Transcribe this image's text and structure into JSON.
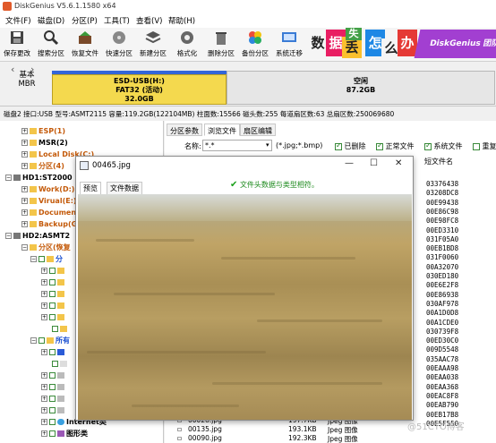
{
  "window": {
    "title": "DiskGenius V5.6.1.1580 x64"
  },
  "menu": [
    "文件(F)",
    "磁盘(D)",
    "分区(P)",
    "工具(T)",
    "查看(V)",
    "帮助(H)"
  ],
  "toolbar": {
    "buttons": [
      {
        "label": "保存更改",
        "icon": "save-icon"
      },
      {
        "label": "搜索分区",
        "icon": "search-icon"
      },
      {
        "label": "恢复文件",
        "icon": "recover-file-icon"
      },
      {
        "label": "快速分区",
        "icon": "quick-partition-icon"
      },
      {
        "label": "新建分区",
        "icon": "new-partition-icon"
      },
      {
        "label": "格式化",
        "icon": "format-icon"
      },
      {
        "label": "删除分区",
        "icon": "delete-icon"
      },
      {
        "label": "备份分区",
        "icon": "backup-icon"
      },
      {
        "label": "系统迁移",
        "icon": "migrate-icon"
      }
    ]
  },
  "banner": {
    "chars": [
      "数",
      "据",
      "丢",
      "失",
      "怎",
      "么",
      "办"
    ],
    "brand": "DiskGenius 团队"
  },
  "diskmap": {
    "label_line1": "基本",
    "label_line2": "MBR",
    "partition": {
      "name": "ESD-USB(H:)",
      "fs": "FAT32 (活动)",
      "size": "32.0GB"
    },
    "free": {
      "name": "空闲",
      "size": "87.2GB"
    }
  },
  "disk_info": "磁盘2 接口:USB  型号:ASMT2115  容量:119.2GB(122104MB)  柱面数:15566  磁头数:255  每道扇区数:63  总扇区数:250069680",
  "tree": [
    {
      "text": "ESP(1)",
      "style": "orange"
    },
    {
      "text": "MSR(2)",
      "style": "bold"
    },
    {
      "text": "Local Disk(C:)",
      "style": "orange"
    },
    {
      "text": "分区(4)",
      "style": "orange"
    },
    {
      "text": "HD1:ST2000",
      "style": "bold"
    },
    {
      "text": "Work(D:)",
      "style": "orange"
    },
    {
      "text": "Virual(E:)",
      "style": "orange"
    },
    {
      "text": "Documen",
      "style": "orange"
    },
    {
      "text": "Backup(G",
      "style": "orange"
    },
    {
      "text": "HD2:ASMT2",
      "style": "bold"
    },
    {
      "text": "分区(恢复",
      "style": "orange"
    },
    {
      "text": "分",
      "style": "blue"
    },
    {
      "text": "所有",
      "style": "blue"
    },
    {
      "text": "Internet类",
      "style": "bold"
    },
    {
      "text": "图形类",
      "style": "bold"
    }
  ],
  "right": {
    "tabs": [
      "分区参数",
      "浏览文件",
      "扇区编辑"
    ],
    "filter": {
      "name_label": "名称:",
      "name_value": "*.*",
      "hint": "(*.jpg;*.bmp)",
      "checks": [
        {
          "label": "已删除",
          "checked": true
        },
        {
          "label": "正常文件",
          "checked": true
        },
        {
          "label": "系统文件",
          "checked": true
        },
        {
          "label": "重复",
          "checked": false
        }
      ]
    },
    "short_name_header": "短文件名",
    "sectors": [
      "03376438",
      "03208DC8",
      "00E99438",
      "00E86C98",
      "00E98FC8",
      "00ED3310",
      "031F05A0",
      "00EB1BD8",
      "031F0060",
      "00A32070",
      "030ED180",
      "00E6E2F8",
      "00E86938",
      "030AF978",
      "00A1D0D8",
      "00A1CDE0",
      "030739F8",
      "00ED30C0",
      "009D5548",
      "035AAC78",
      "00EAAA98",
      "00EAA038",
      "00EAA368",
      "00EAC8F8",
      "00EAB790",
      "00EB17B8",
      "00E5F550"
    ],
    "files": [
      {
        "name": "00028.jpg",
        "size": "197.7KB",
        "type": "Jpeg 图像"
      },
      {
        "name": "00135.jpg",
        "size": "193.1KB",
        "type": "Jpeg 图像"
      },
      {
        "name": "00090.jpg",
        "size": "192.3KB",
        "type": "Jpeg 图像"
      }
    ]
  },
  "preview": {
    "title": "00465.jpg",
    "tabs": [
      "预览",
      "文件数据"
    ],
    "message": "文件头数据与类型相符。",
    "controls": [
      "—",
      "☐",
      "✕"
    ]
  },
  "watermark": "@51CTO博客",
  "colors": {
    "partition": "#f4d94e",
    "partition_cap": "#3466d8",
    "free": "#e6e6e6",
    "brand": "#a23fd1",
    "ok": "#1d8a1d"
  }
}
